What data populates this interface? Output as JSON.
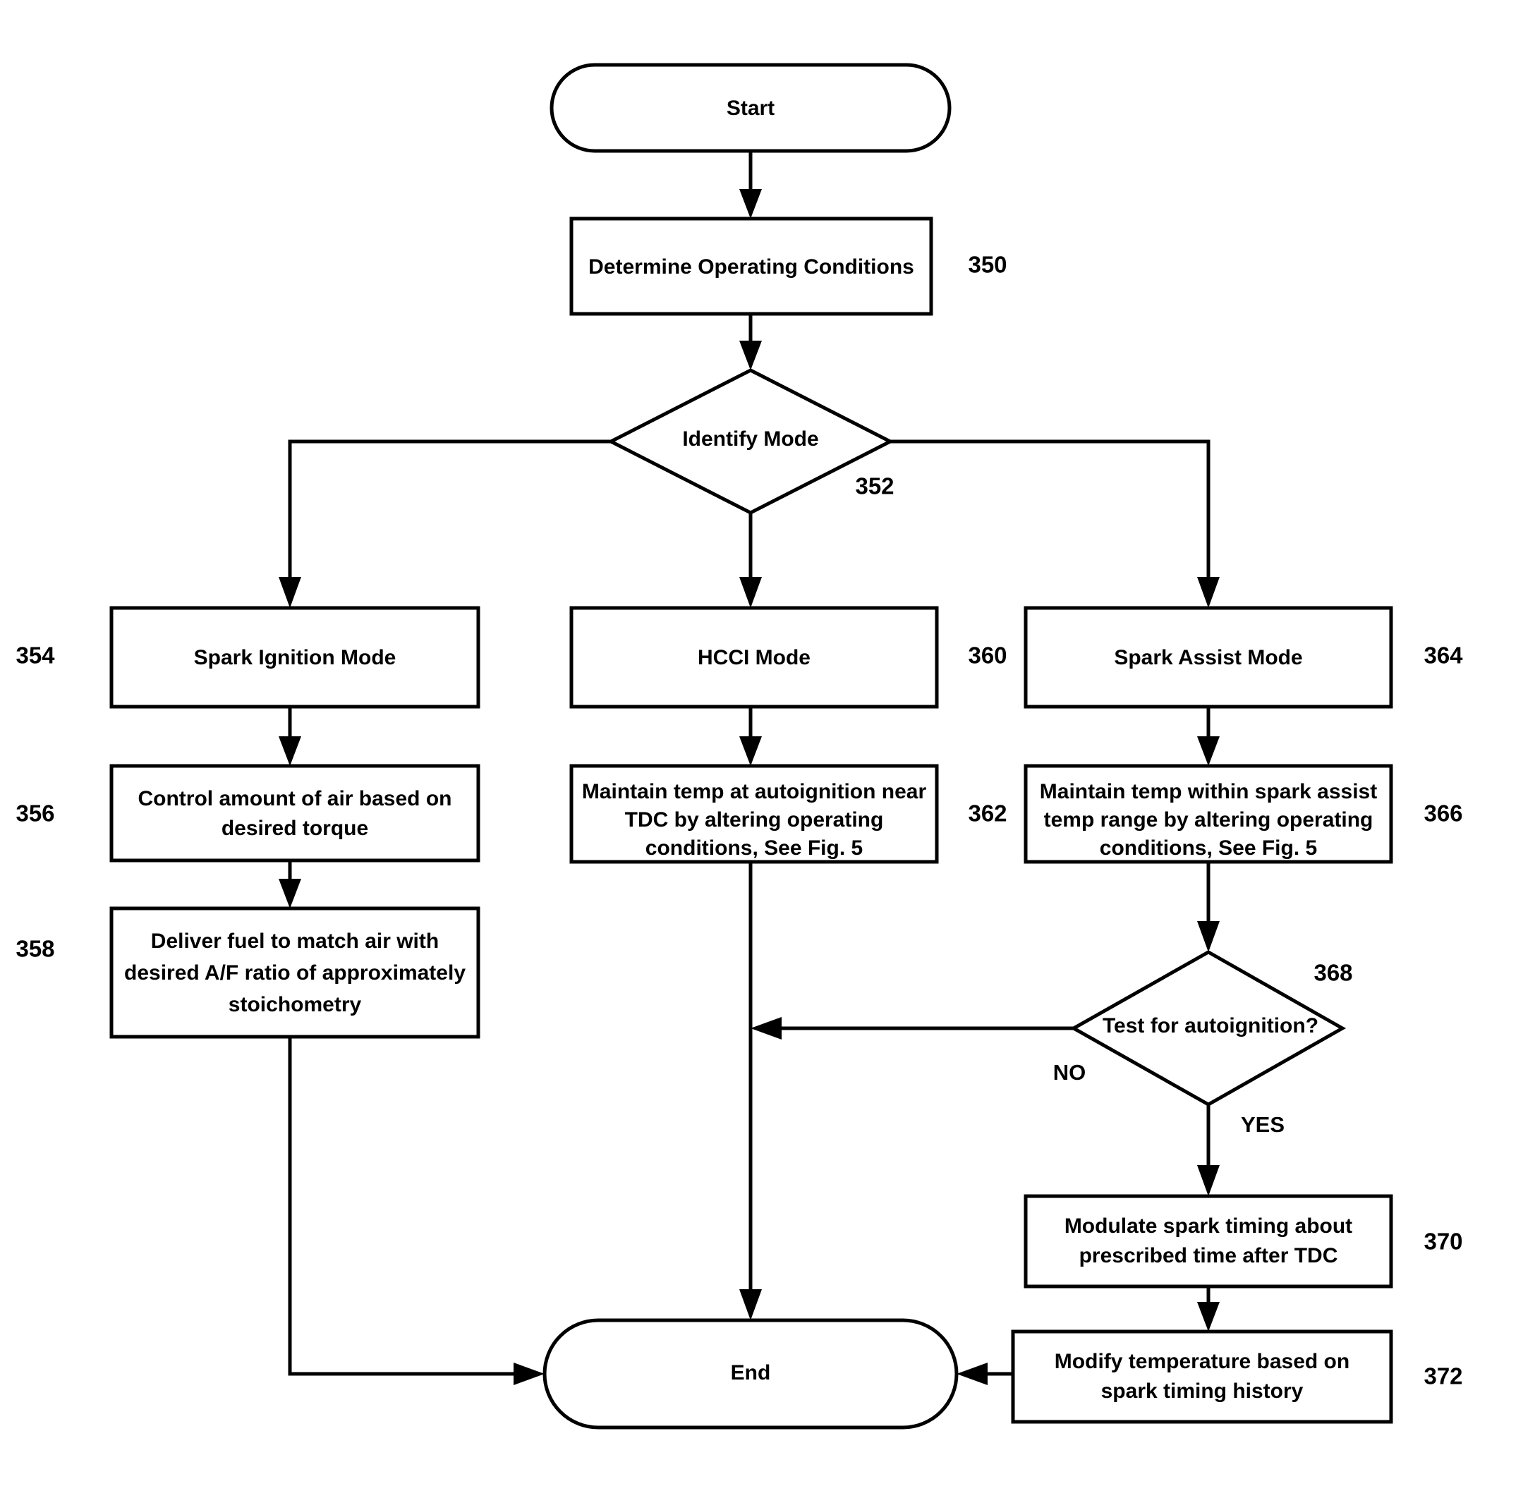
{
  "figure": {
    "type": "flowchart",
    "orientation": "top-down",
    "background_color": "#ffffff",
    "line_color": "#000000",
    "text_color": "#000000"
  },
  "nodes": {
    "start": {
      "label": "Start",
      "shape": "stadium"
    },
    "determine": {
      "label": "Determine Operating Conditions",
      "shape": "rectangle",
      "ref": "350"
    },
    "identify": {
      "label": "Identify Mode",
      "shape": "diamond",
      "ref": "352"
    },
    "spark_ignition_mode": {
      "label": "Spark Ignition Mode",
      "shape": "rectangle",
      "ref": "354"
    },
    "control_air": {
      "line1": "Control amount of air based on",
      "line2": "desired torque",
      "shape": "rectangle",
      "ref": "356"
    },
    "deliver_fuel": {
      "line1": "Deliver fuel to match air with",
      "line2": "desired A/F ratio of approximately",
      "line3": "stoichometry",
      "shape": "rectangle",
      "ref": "358"
    },
    "hcci_mode": {
      "label": "HCCI Mode",
      "shape": "rectangle",
      "ref": "360"
    },
    "hcci_maintain": {
      "line1": "Maintain temp at autoignition near",
      "line2": "TDC by altering operating",
      "line3": "conditions, See Fig. 5",
      "shape": "rectangle",
      "ref": "362"
    },
    "spark_assist_mode": {
      "label": "Spark Assist Mode",
      "shape": "rectangle",
      "ref": "364"
    },
    "assist_maintain": {
      "line1": "Maintain temp within spark assist",
      "line2": "temp range by altering operating",
      "line3": "conditions, See Fig. 5",
      "shape": "rectangle",
      "ref": "366"
    },
    "test_autoignition": {
      "label": "Test for autoignition?",
      "shape": "diamond",
      "ref": "368"
    },
    "modulate_spark": {
      "line1": "Modulate spark timing about",
      "line2": "prescribed time after TDC",
      "shape": "rectangle",
      "ref": "370"
    },
    "modify_temp": {
      "line1": "Modify temperature based on",
      "line2": "spark timing history",
      "shape": "rectangle",
      "ref": "372"
    },
    "end": {
      "label": "End",
      "shape": "stadium"
    }
  },
  "edge_labels": {
    "no": "NO",
    "yes": "YES"
  }
}
